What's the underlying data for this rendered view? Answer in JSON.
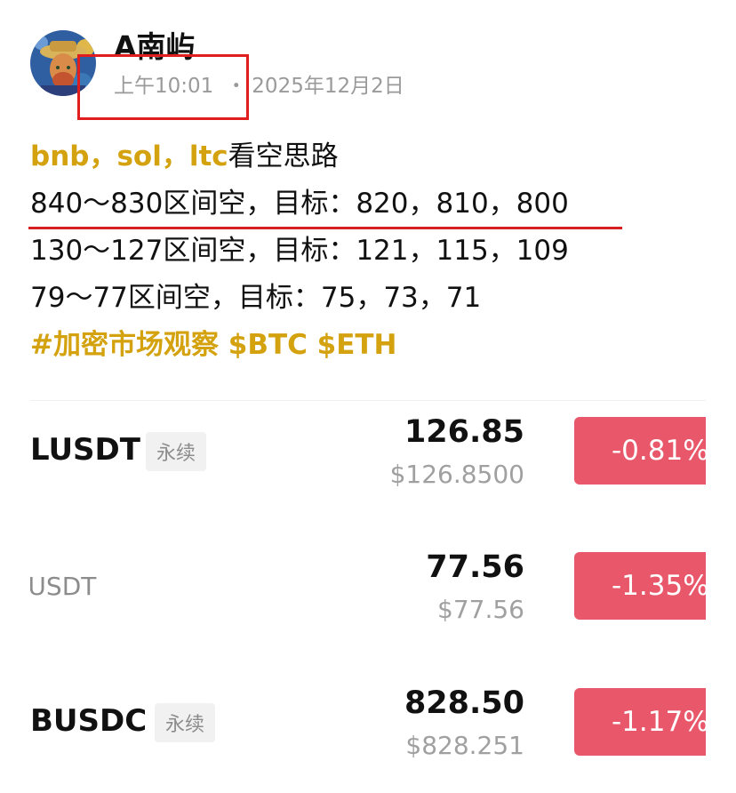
{
  "post": {
    "author": "A南屿",
    "time": "上午10:01",
    "separator": "・",
    "date": "2025年12月2日",
    "avatar_icon": "van-gogh-portrait-avatar"
  },
  "body": {
    "line1_coins": "bnb，sol，ltc",
    "line1_suffix": "看空思路",
    "line2": "840～830区间空，目标：820，810，800",
    "line3": "130～127区间空，目标：121，115，109",
    "line4": "79～77区间空，目标：75，73，71",
    "hashtags": "#加密市场观察 $BTC $ETH"
  },
  "tickers": [
    {
      "symbol": "LUSDT",
      "tag": "永续",
      "price": "126.85",
      "usd_price": "$126.8500",
      "change": "-0.81%"
    },
    {
      "symbol": "/USDT",
      "tag": "",
      "price": "77.56",
      "usd_price": "$77.56",
      "change": "-1.35%"
    },
    {
      "symbol": "BUSDC",
      "tag": "永续",
      "price": "828.50",
      "usd_price": "$828.251",
      "change": "-1.17%"
    }
  ],
  "colors": {
    "accent": "#d4a20f",
    "highlight_red": "#e01e1e",
    "negative_badge": "#e8586a",
    "muted_text": "#9a9a9a"
  }
}
